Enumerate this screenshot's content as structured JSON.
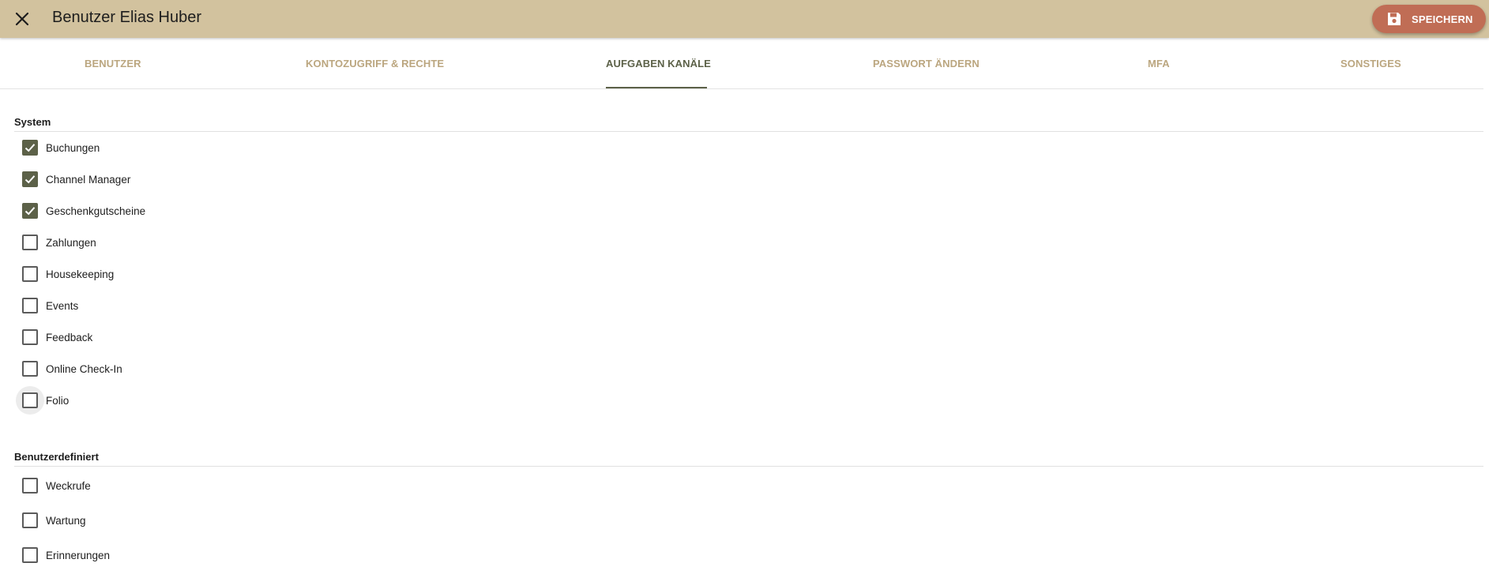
{
  "header": {
    "title": "Benutzer Elias Huber",
    "save_label": "SPEICHERN"
  },
  "tabs": [
    {
      "label": "BENUTZER",
      "active": false
    },
    {
      "label": "KONTOZUGRIFF & RECHTE",
      "active": false
    },
    {
      "label": "AUFGABEN KANÄLE",
      "active": true
    },
    {
      "label": "PASSWORT ÄNDERN",
      "active": false
    },
    {
      "label": "MFA",
      "active": false
    },
    {
      "label": "SONSTIGES",
      "active": false
    }
  ],
  "sections": [
    {
      "title": "System",
      "items": [
        {
          "label": "Buchungen",
          "checked": true
        },
        {
          "label": "Channel Manager",
          "checked": true
        },
        {
          "label": "Geschenkgutscheine",
          "checked": true
        },
        {
          "label": "Zahlungen",
          "checked": false
        },
        {
          "label": "Housekeeping",
          "checked": false
        },
        {
          "label": "Events",
          "checked": false
        },
        {
          "label": "Feedback",
          "checked": false
        },
        {
          "label": "Online Check-In",
          "checked": false
        },
        {
          "label": "Folio",
          "checked": false
        }
      ]
    },
    {
      "title": "Benutzerdefiniert",
      "items": [
        {
          "label": "Weckrufe",
          "checked": false
        },
        {
          "label": "Wartung",
          "checked": false
        },
        {
          "label": "Erinnerungen",
          "checked": false
        }
      ]
    }
  ],
  "colors": {
    "topbar": "#d2c29e",
    "save_button": "#c06d55",
    "accent": "#5c6148",
    "tab_inactive": "#bba67f"
  }
}
